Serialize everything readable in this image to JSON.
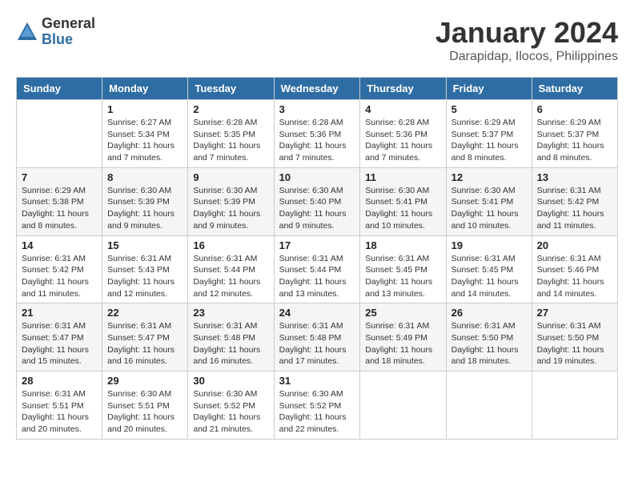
{
  "logo": {
    "general": "General",
    "blue": "Blue"
  },
  "title": "January 2024",
  "location": "Darapidap, Ilocos, Philippines",
  "header": {
    "days": [
      "Sunday",
      "Monday",
      "Tuesday",
      "Wednesday",
      "Thursday",
      "Friday",
      "Saturday"
    ]
  },
  "weeks": [
    [
      {
        "day": "",
        "sunrise": "",
        "sunset": "",
        "daylight": ""
      },
      {
        "day": "1",
        "sunrise": "Sunrise: 6:27 AM",
        "sunset": "Sunset: 5:34 PM",
        "daylight": "Daylight: 11 hours and 7 minutes."
      },
      {
        "day": "2",
        "sunrise": "Sunrise: 6:28 AM",
        "sunset": "Sunset: 5:35 PM",
        "daylight": "Daylight: 11 hours and 7 minutes."
      },
      {
        "day": "3",
        "sunrise": "Sunrise: 6:28 AM",
        "sunset": "Sunset: 5:36 PM",
        "daylight": "Daylight: 11 hours and 7 minutes."
      },
      {
        "day": "4",
        "sunrise": "Sunrise: 6:28 AM",
        "sunset": "Sunset: 5:36 PM",
        "daylight": "Daylight: 11 hours and 7 minutes."
      },
      {
        "day": "5",
        "sunrise": "Sunrise: 6:29 AM",
        "sunset": "Sunset: 5:37 PM",
        "daylight": "Daylight: 11 hours and 8 minutes."
      },
      {
        "day": "6",
        "sunrise": "Sunrise: 6:29 AM",
        "sunset": "Sunset: 5:37 PM",
        "daylight": "Daylight: 11 hours and 8 minutes."
      }
    ],
    [
      {
        "day": "7",
        "sunrise": "Sunrise: 6:29 AM",
        "sunset": "Sunset: 5:38 PM",
        "daylight": "Daylight: 11 hours and 8 minutes."
      },
      {
        "day": "8",
        "sunrise": "Sunrise: 6:30 AM",
        "sunset": "Sunset: 5:39 PM",
        "daylight": "Daylight: 11 hours and 9 minutes."
      },
      {
        "day": "9",
        "sunrise": "Sunrise: 6:30 AM",
        "sunset": "Sunset: 5:39 PM",
        "daylight": "Daylight: 11 hours and 9 minutes."
      },
      {
        "day": "10",
        "sunrise": "Sunrise: 6:30 AM",
        "sunset": "Sunset: 5:40 PM",
        "daylight": "Daylight: 11 hours and 9 minutes."
      },
      {
        "day": "11",
        "sunrise": "Sunrise: 6:30 AM",
        "sunset": "Sunset: 5:41 PM",
        "daylight": "Daylight: 11 hours and 10 minutes."
      },
      {
        "day": "12",
        "sunrise": "Sunrise: 6:30 AM",
        "sunset": "Sunset: 5:41 PM",
        "daylight": "Daylight: 11 hours and 10 minutes."
      },
      {
        "day": "13",
        "sunrise": "Sunrise: 6:31 AM",
        "sunset": "Sunset: 5:42 PM",
        "daylight": "Daylight: 11 hours and 11 minutes."
      }
    ],
    [
      {
        "day": "14",
        "sunrise": "Sunrise: 6:31 AM",
        "sunset": "Sunset: 5:42 PM",
        "daylight": "Daylight: 11 hours and 11 minutes."
      },
      {
        "day": "15",
        "sunrise": "Sunrise: 6:31 AM",
        "sunset": "Sunset: 5:43 PM",
        "daylight": "Daylight: 11 hours and 12 minutes."
      },
      {
        "day": "16",
        "sunrise": "Sunrise: 6:31 AM",
        "sunset": "Sunset: 5:44 PM",
        "daylight": "Daylight: 11 hours and 12 minutes."
      },
      {
        "day": "17",
        "sunrise": "Sunrise: 6:31 AM",
        "sunset": "Sunset: 5:44 PM",
        "daylight": "Daylight: 11 hours and 13 minutes."
      },
      {
        "day": "18",
        "sunrise": "Sunrise: 6:31 AM",
        "sunset": "Sunset: 5:45 PM",
        "daylight": "Daylight: 11 hours and 13 minutes."
      },
      {
        "day": "19",
        "sunrise": "Sunrise: 6:31 AM",
        "sunset": "Sunset: 5:45 PM",
        "daylight": "Daylight: 11 hours and 14 minutes."
      },
      {
        "day": "20",
        "sunrise": "Sunrise: 6:31 AM",
        "sunset": "Sunset: 5:46 PM",
        "daylight": "Daylight: 11 hours and 14 minutes."
      }
    ],
    [
      {
        "day": "21",
        "sunrise": "Sunrise: 6:31 AM",
        "sunset": "Sunset: 5:47 PM",
        "daylight": "Daylight: 11 hours and 15 minutes."
      },
      {
        "day": "22",
        "sunrise": "Sunrise: 6:31 AM",
        "sunset": "Sunset: 5:47 PM",
        "daylight": "Daylight: 11 hours and 16 minutes."
      },
      {
        "day": "23",
        "sunrise": "Sunrise: 6:31 AM",
        "sunset": "Sunset: 5:48 PM",
        "daylight": "Daylight: 11 hours and 16 minutes."
      },
      {
        "day": "24",
        "sunrise": "Sunrise: 6:31 AM",
        "sunset": "Sunset: 5:48 PM",
        "daylight": "Daylight: 11 hours and 17 minutes."
      },
      {
        "day": "25",
        "sunrise": "Sunrise: 6:31 AM",
        "sunset": "Sunset: 5:49 PM",
        "daylight": "Daylight: 11 hours and 18 minutes."
      },
      {
        "day": "26",
        "sunrise": "Sunrise: 6:31 AM",
        "sunset": "Sunset: 5:50 PM",
        "daylight": "Daylight: 11 hours and 18 minutes."
      },
      {
        "day": "27",
        "sunrise": "Sunrise: 6:31 AM",
        "sunset": "Sunset: 5:50 PM",
        "daylight": "Daylight: 11 hours and 19 minutes."
      }
    ],
    [
      {
        "day": "28",
        "sunrise": "Sunrise: 6:31 AM",
        "sunset": "Sunset: 5:51 PM",
        "daylight": "Daylight: 11 hours and 20 minutes."
      },
      {
        "day": "29",
        "sunrise": "Sunrise: 6:30 AM",
        "sunset": "Sunset: 5:51 PM",
        "daylight": "Daylight: 11 hours and 20 minutes."
      },
      {
        "day": "30",
        "sunrise": "Sunrise: 6:30 AM",
        "sunset": "Sunset: 5:52 PM",
        "daylight": "Daylight: 11 hours and 21 minutes."
      },
      {
        "day": "31",
        "sunrise": "Sunrise: 6:30 AM",
        "sunset": "Sunset: 5:52 PM",
        "daylight": "Daylight: 11 hours and 22 minutes."
      },
      {
        "day": "",
        "sunrise": "",
        "sunset": "",
        "daylight": ""
      },
      {
        "day": "",
        "sunrise": "",
        "sunset": "",
        "daylight": ""
      },
      {
        "day": "",
        "sunrise": "",
        "sunset": "",
        "daylight": ""
      }
    ]
  ]
}
